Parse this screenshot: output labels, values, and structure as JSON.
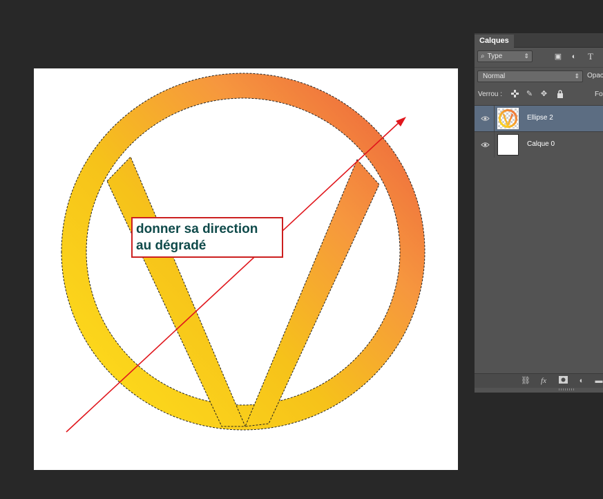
{
  "canvas": {
    "annotation": {
      "line1": "donner sa direction",
      "line2": "au dégradé"
    },
    "gradient_colors": [
      "#ffe11c",
      "#f6c21a",
      "#f6973e",
      "#ee6a3c"
    ],
    "arrow_color": "#e0161c"
  },
  "layers_panel": {
    "tab_label": "Calques",
    "filter": {
      "value": "Type",
      "icon": "search-icon"
    },
    "filter_icons": [
      "image-filter-icon",
      "adjustment-filter-icon",
      "text-filter-icon"
    ],
    "blend_mode": "Normal",
    "opacity_label": "Opac",
    "lock_label": "Verrou :",
    "lock_icons": [
      "lock-transparent-icon",
      "lock-paint-icon",
      "lock-position-icon",
      "lock-all-icon"
    ],
    "fill_label": "Fo",
    "layers": [
      {
        "name": "Ellipse 2",
        "selected": true,
        "visible": true
      },
      {
        "name": "Calque 0",
        "selected": false,
        "visible": true
      }
    ],
    "bottom_icons": [
      "link-icon",
      "fx-icon",
      "mask-icon",
      "adjustment-icon",
      "folder-icon"
    ],
    "fx_label": "fx"
  }
}
